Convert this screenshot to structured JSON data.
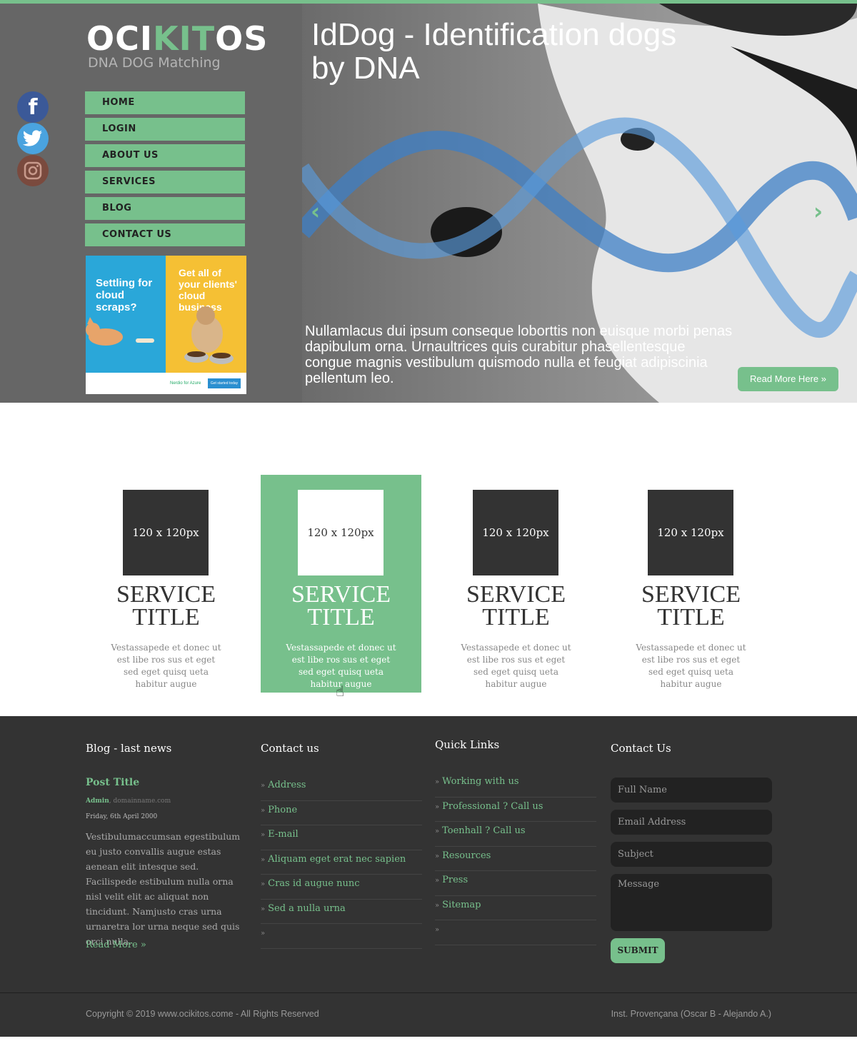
{
  "colors": {
    "accent": "#77c08c",
    "dark": "#333333",
    "header_bg": "#666666"
  },
  "logo": {
    "part1": "OCI",
    "part2": "KIT",
    "part3": "OS",
    "tagline": "DNA DOG Matching"
  },
  "social": {
    "facebook": "f",
    "twitter": "twitter-icon",
    "instagram": "instagram-icon"
  },
  "menu": [
    "HOME",
    "LOGIN",
    "ABOUT US",
    "SERVICES",
    "BLOG",
    "CONTACT US"
  ],
  "ad": {
    "left_text": "Settling for cloud scraps?",
    "right_text": "Get all of your clients' cloud business",
    "brand": "Nerdio for Azure",
    "cta": "Get started today"
  },
  "hero": {
    "title": "IdDog - Identification dogs by DNA",
    "text": "Nullamlacus dui ipsum conseque loborttis non euisque morbi penas dapibulum orna. Urnaultrices quis curabitur phasellentesque congue magnis vestibulum quismodo nulla et feugiat adipiscinia pellentum leo.",
    "read_more": "Read More Here »",
    "prev": "‹",
    "next": "›"
  },
  "services": [
    {
      "img": "120 x 120px",
      "title": "SERVICE TITLE",
      "desc": "Vestassapede et donec ut est libe ros sus et eget sed eget quisq ueta habitur augue"
    },
    {
      "img": "120 x 120px",
      "title": "SERVICE TITLE",
      "desc": "Vestassapede et donec ut est libe ros sus et eget sed eget quisq ueta habitur augue"
    },
    {
      "img": "120 x 120px",
      "title": "SERVICE TITLE",
      "desc": "Vestassapede et donec ut est libe ros sus et eget sed eget quisq ueta habitur augue"
    },
    {
      "img": "120 x 120px",
      "title": "SERVICE TITLE",
      "desc": "Vestassapede et donec ut est libe ros sus et eget sed eget quisq ueta habitur augue"
    }
  ],
  "footer": {
    "blog": {
      "title": "Blog - last news",
      "post_title": "Post Title",
      "author": "Admin",
      "domain": ", domainname.com",
      "date": "Friday, 6th April 2000",
      "body": "Vestibulumaccumsan egestibulum eu justo convallis augue estas aenean elit intesque sed. Facilispede estibulum nulla orna nisl velit elit ac aliquat non tincidunt. Namjusto cras urna urnaretra lor urna neque sed quis orci nulla.",
      "read_more": "Read More »"
    },
    "contact": {
      "title": "Contact us",
      "links": [
        "Address",
        "Phone",
        "E-mail",
        "Aliquam eget erat nec sapien",
        "Cras id augue nunc",
        "Sed a nulla urna",
        ""
      ]
    },
    "quick": {
      "title": "Quick Links",
      "links": [
        "Working with us",
        "Professional ? Call us",
        "Toenhall ? Call us",
        "Resources",
        "Press",
        "Sitemap",
        ""
      ]
    },
    "form": {
      "title": "Contact Us",
      "full_name": "Full Name",
      "email": "Email Address",
      "subject": "Subject",
      "message": "Message",
      "submit": "SUBMIT"
    },
    "copyright": "Copyright © 2019 www.ocikitos.come - All Rights Reserved",
    "credits": "Inst. Provençana (Oscar B - Alejando A.)"
  }
}
